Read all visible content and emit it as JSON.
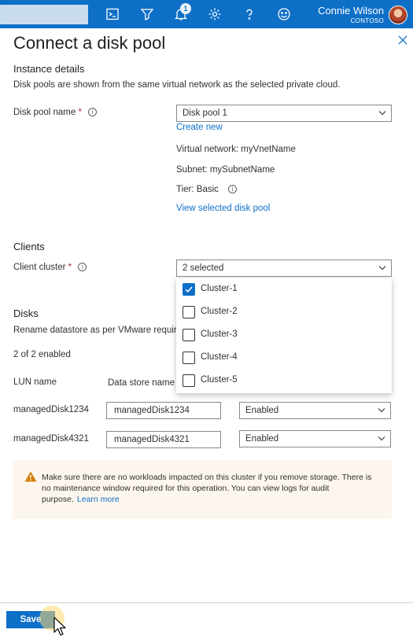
{
  "topbar": {
    "notification_count": "1",
    "user_name": "Connie Wilson",
    "tenant": "CONTOSO",
    "icons": [
      "cloud-shell-icon",
      "directory-filter-icon",
      "notifications-icon",
      "settings-icon",
      "help-icon",
      "feedback-icon"
    ]
  },
  "panel": {
    "title": "Connect a disk pool",
    "close_icon": "close-icon"
  },
  "instance": {
    "section_title": "Instance details",
    "description": "Disk pools are shown from the same virtual network as the selected private cloud.",
    "disk_pool_label": "Disk pool name",
    "required_mark": "*",
    "info_glyph": "i",
    "disk_pool_value": "Disk pool 1",
    "create_new": "Create new",
    "virtual_network": "Virtual network: myVnetName",
    "subnet": "Subnet: mySubnetName",
    "tier": "Tier: Basic",
    "view_link": "View selected disk pool"
  },
  "clients": {
    "section_title": "Clients",
    "client_cluster_label": "Client cluster",
    "selected_value": "2 selected",
    "options": [
      {
        "label": "Cluster-1",
        "checked": true
      },
      {
        "label": "Cluster-2",
        "checked": false
      },
      {
        "label": "Cluster-3",
        "checked": false
      },
      {
        "label": "Cluster-4",
        "checked": false
      },
      {
        "label": "Cluster-5",
        "checked": false
      }
    ]
  },
  "disks": {
    "section_title": "Disks",
    "description": "Rename datastore as per VMware requir",
    "enabled_count": "2 of 2 enabled",
    "columns": [
      "LUN name",
      "Data store name"
    ],
    "rows": [
      {
        "lun": "managedDisk1234",
        "datastore": "managedDisk1234",
        "status": "Enabled"
      },
      {
        "lun": "managedDisk4321",
        "datastore": "managedDisk4321",
        "status": "Enabled"
      }
    ]
  },
  "warning": {
    "text": "Make sure there are no workloads impacted on this cluster if you remove storage. There is no maintenance window required for this operation. You can view logs for audit purpose.",
    "link": "Learn more",
    "color": "#d67f0a",
    "background": "#fdf6ee"
  },
  "footer": {
    "save_label": "Save"
  },
  "colors": {
    "brand": "#0e6fc7",
    "required": "#a4262c"
  }
}
